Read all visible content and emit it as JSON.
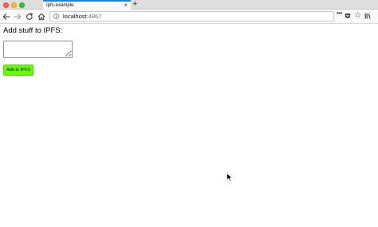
{
  "browser": {
    "tab": {
      "title": "Ipfs-example",
      "close_glyph": "×"
    },
    "new_tab_glyph": "+",
    "url": {
      "host": "localhost",
      "port": ":4867"
    },
    "icons": {
      "back": "back-arrow-icon",
      "forward": "forward-arrow-icon",
      "reload": "reload-icon",
      "home": "home-icon",
      "info": "info-icon",
      "more": "page-actions-icon",
      "pocket": "pocket-icon",
      "star": "bookmark-star-icon",
      "library": "library-icon"
    },
    "more_glyph": "•••",
    "star_glyph": "☆"
  },
  "page": {
    "title": "Add stuff to IPFS:",
    "input": {
      "value": "",
      "placeholder": ""
    },
    "add_button_label": "Add to IPFS"
  },
  "colors": {
    "add_button": "#66ff00",
    "tab_accent": "#0a84ff"
  }
}
